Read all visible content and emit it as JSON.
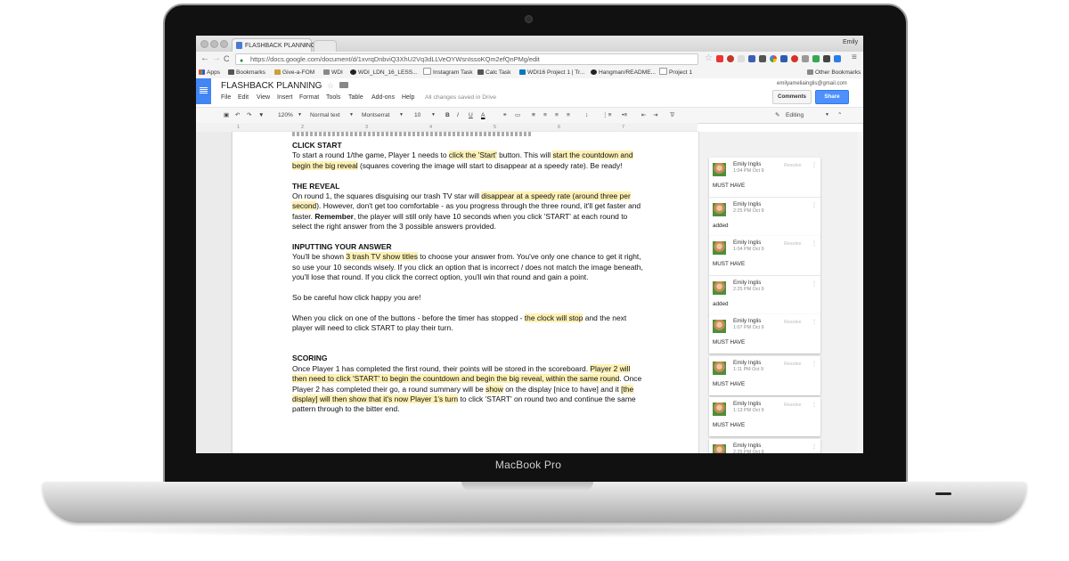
{
  "device": {
    "label": "MacBook Pro"
  },
  "browser": {
    "tab_title": "FLASHBACK PLANNING",
    "user": "Emily",
    "nav": {
      "back": "←",
      "forward": "→",
      "reload": "C"
    },
    "url": "https://docs.google.com/document/d/1xvrqDnbviQ3XhU2Vq3dLLVeOYWsnIssoKQm2efQnPMg/edit",
    "bookmarks": [
      "Apps",
      "Bookmarks",
      "Give-a-FOM",
      "WDI",
      "WDI_LDN_16_LESS...",
      "Instagram Task",
      "Calc Task",
      "WDI16 Project 1 | Tr...",
      "Hangman/README...",
      "Project 1"
    ],
    "other_bookmarks": "Other Bookmarks"
  },
  "docs": {
    "title": "FLASHBACK PLANNING",
    "menu": [
      "File",
      "Edit",
      "View",
      "Insert",
      "Format",
      "Tools",
      "Table",
      "Add-ons",
      "Help"
    ],
    "save_status": "All changes saved in Drive",
    "account_email": "emilyameliainglis@gmail.com",
    "comments_button": "Comments",
    "share_button": "Share",
    "toolbar": {
      "zoom": "120%",
      "style": "Normal text",
      "font": "Montserrat",
      "size": "10",
      "bold": "B",
      "italic": "I",
      "underline": "U",
      "text_color": "A",
      "mode": "Editing"
    },
    "ruler": [
      "1",
      "2",
      "3",
      "4",
      "5",
      "6",
      "7"
    ]
  },
  "document": {
    "sections": [
      {
        "heading": "CLICK START",
        "paragraphs": [
          [
            {
              "t": "To start a round 1/the game, Player 1 needs to "
            },
            {
              "t": "click the 'Start'",
              "hl": true
            },
            {
              "t": " button. This will "
            },
            {
              "t": "start the countdown and begin the big reveal",
              "hl": true
            },
            {
              "t": " (squares covering the image will start to disappear at a speedy rate). Be ready!"
            }
          ]
        ]
      },
      {
        "heading": "THE REVEAL",
        "paragraphs": [
          [
            {
              "t": "On round 1, the squares disguising our trash TV star will "
            },
            {
              "t": "disappear at a speedy rate (around three per second",
              "hl": true
            },
            {
              "t": "). However, don't get too comfortable - as you progress through the three round, it'll get faster and faster. "
            },
            {
              "t": "Remember",
              "b": true
            },
            {
              "t": ", the player will still only have 10 seconds when you click 'START' at each round to select the right answer from the 3 possible answers provided."
            }
          ]
        ]
      },
      {
        "heading": "INPUTTING YOUR ANSWER",
        "paragraphs": [
          [
            {
              "t": "You'll be shown "
            },
            {
              "t": "3 trash TV show titles",
              "hl": true
            },
            {
              "t": " to choose your answer from. You've only one chance to get it right, so use your 10 seconds wisely. If you click an option that is incorrect / does not match the image beneath, you'll lose that round. If you click the correct option, you'll win that round and gain a point."
            }
          ],
          [
            {
              "t": "So be careful how click happy you are!"
            }
          ],
          [
            {
              "t": "When you click on one of the buttons - before the timer has stopped - "
            },
            {
              "t": "the clock will stop",
              "hl": true
            },
            {
              "t": " and the next player will need to click START to play their turn."
            }
          ]
        ]
      },
      {
        "heading": "SCORING",
        "paragraphs": [
          [
            {
              "t": "Once Player 1 has completed the first round, their points will be stored in the scoreboard. "
            },
            {
              "t": "Player 2 will then need to click 'START' to begin the countdown and begin the big reveal, within the same round",
              "hl": true
            },
            {
              "t": ". Once Player 2 has completed their go, a round summary will be "
            },
            {
              "t": "show",
              "hl": true
            },
            {
              "t": " on the display [nice to have] and it "
            },
            {
              "t": "[the display] will then show that it's now Player 1's turn",
              "hl": true
            },
            {
              "t": " to click 'START' on round two and continue the same pattern through to the bitter end."
            }
          ]
        ]
      }
    ]
  },
  "comments": {
    "threads": [
      {
        "entries": [
          {
            "author": "Emily Inglis",
            "time": "1:04 PM Oct 9",
            "text": "MUST HAVE",
            "action": "Resolve"
          },
          {
            "author": "Emily Inglis",
            "time": "2:25 PM Oct 9",
            "text": "added"
          }
        ]
      },
      {
        "entries": [
          {
            "author": "Emily Inglis",
            "time": "1:04 PM Oct 9",
            "text": "MUST HAVE",
            "action": "Resolve"
          },
          {
            "author": "Emily Inglis",
            "time": "2:25 PM Oct 9",
            "text": "added"
          }
        ]
      },
      {
        "entries": [
          {
            "author": "Emily Inglis",
            "time": "1:07 PM Oct 9",
            "text": "MUST HAVE",
            "action": "Resolve"
          }
        ]
      },
      {
        "entries": [
          {
            "author": "Emily Inglis",
            "time": "1:11 PM Oct 9",
            "text": "MUST HAVE",
            "action": "Resolve"
          }
        ]
      },
      {
        "entries": [
          {
            "author": "Emily Inglis",
            "time": "1:13 PM Oct 9",
            "text": "MUST HAVE",
            "action": "Resolve"
          }
        ]
      },
      {
        "entries": [
          {
            "author": "Emily Inglis",
            "time": "2:25 PM Oct 9",
            "text": ""
          }
        ]
      }
    ]
  },
  "colors": {
    "highlight": "#fdf1b6",
    "docs_blue": "#4285f4",
    "share_blue": "#4d90fe"
  }
}
